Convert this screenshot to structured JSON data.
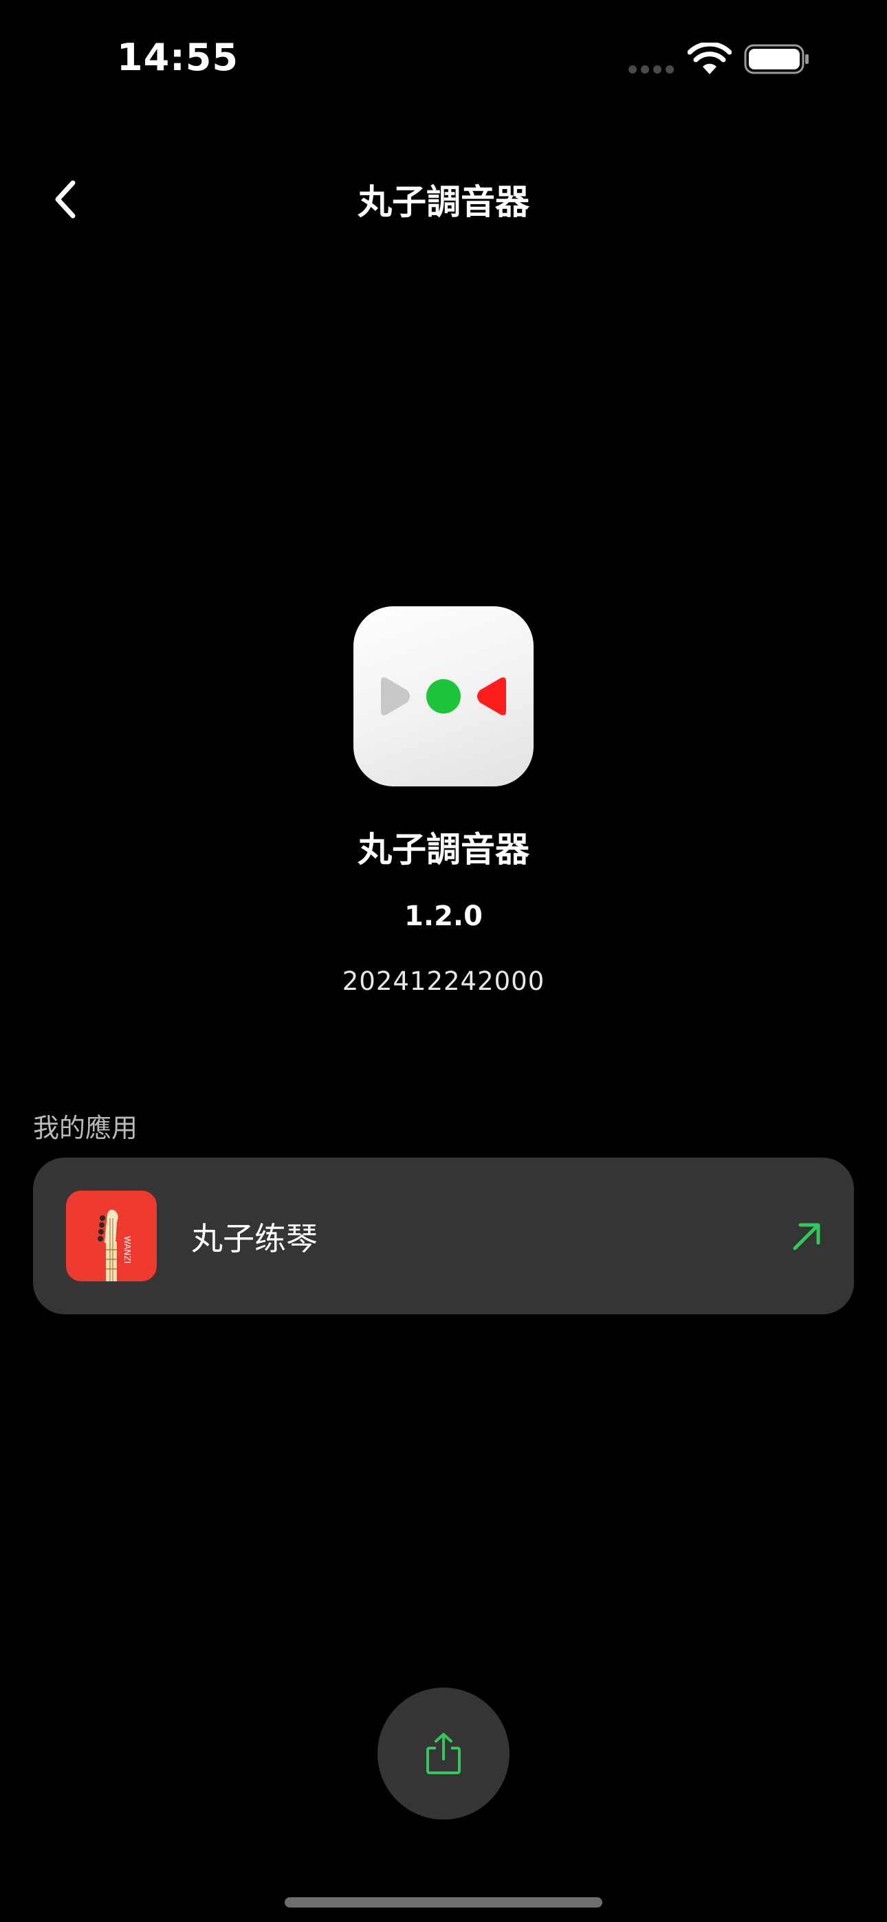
{
  "status_bar": {
    "time": "14:55",
    "icons": [
      "signal-icon",
      "wifi-icon",
      "battery-icon"
    ]
  },
  "nav": {
    "back_icon": "chevron-left-icon",
    "title": "丸子調音器"
  },
  "app": {
    "name": "丸子調音器",
    "version": "1.2.0",
    "build": "202412242000",
    "icon": "tuner-app-icon"
  },
  "my_apps": {
    "section_title": "我的應用",
    "items": [
      {
        "label": "丸子练琴",
        "icon": "guitar-headstock-app-icon",
        "icon_caption": "WANZI",
        "action_icon": "arrow-up-right-icon"
      }
    ]
  },
  "share": {
    "icon": "share-icon"
  },
  "colors": {
    "background": "#000000",
    "card": "#353535",
    "accent_green": "#34c759",
    "tuner_green": "#1ec53a",
    "tuner_red": "#ff1e1e",
    "app_icon_red": "#ef3a2f"
  }
}
